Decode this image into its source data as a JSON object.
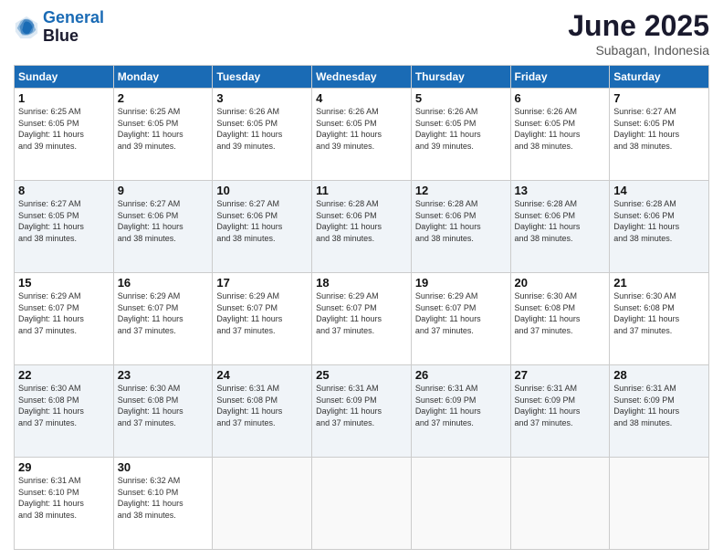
{
  "logo": {
    "line1": "General",
    "line2": "Blue"
  },
  "header": {
    "month": "June 2025",
    "location": "Subagan, Indonesia"
  },
  "weekdays": [
    "Sunday",
    "Monday",
    "Tuesday",
    "Wednesday",
    "Thursday",
    "Friday",
    "Saturday"
  ],
  "weeks": [
    [
      {
        "day": "1",
        "info": "Sunrise: 6:25 AM\nSunset: 6:05 PM\nDaylight: 11 hours\nand 39 minutes."
      },
      {
        "day": "2",
        "info": "Sunrise: 6:25 AM\nSunset: 6:05 PM\nDaylight: 11 hours\nand 39 minutes."
      },
      {
        "day": "3",
        "info": "Sunrise: 6:26 AM\nSunset: 6:05 PM\nDaylight: 11 hours\nand 39 minutes."
      },
      {
        "day": "4",
        "info": "Sunrise: 6:26 AM\nSunset: 6:05 PM\nDaylight: 11 hours\nand 39 minutes."
      },
      {
        "day": "5",
        "info": "Sunrise: 6:26 AM\nSunset: 6:05 PM\nDaylight: 11 hours\nand 39 minutes."
      },
      {
        "day": "6",
        "info": "Sunrise: 6:26 AM\nSunset: 6:05 PM\nDaylight: 11 hours\nand 38 minutes."
      },
      {
        "day": "7",
        "info": "Sunrise: 6:27 AM\nSunset: 6:05 PM\nDaylight: 11 hours\nand 38 minutes."
      }
    ],
    [
      {
        "day": "8",
        "info": "Sunrise: 6:27 AM\nSunset: 6:05 PM\nDaylight: 11 hours\nand 38 minutes."
      },
      {
        "day": "9",
        "info": "Sunrise: 6:27 AM\nSunset: 6:06 PM\nDaylight: 11 hours\nand 38 minutes."
      },
      {
        "day": "10",
        "info": "Sunrise: 6:27 AM\nSunset: 6:06 PM\nDaylight: 11 hours\nand 38 minutes."
      },
      {
        "day": "11",
        "info": "Sunrise: 6:28 AM\nSunset: 6:06 PM\nDaylight: 11 hours\nand 38 minutes."
      },
      {
        "day": "12",
        "info": "Sunrise: 6:28 AM\nSunset: 6:06 PM\nDaylight: 11 hours\nand 38 minutes."
      },
      {
        "day": "13",
        "info": "Sunrise: 6:28 AM\nSunset: 6:06 PM\nDaylight: 11 hours\nand 38 minutes."
      },
      {
        "day": "14",
        "info": "Sunrise: 6:28 AM\nSunset: 6:06 PM\nDaylight: 11 hours\nand 38 minutes."
      }
    ],
    [
      {
        "day": "15",
        "info": "Sunrise: 6:29 AM\nSunset: 6:07 PM\nDaylight: 11 hours\nand 37 minutes."
      },
      {
        "day": "16",
        "info": "Sunrise: 6:29 AM\nSunset: 6:07 PM\nDaylight: 11 hours\nand 37 minutes."
      },
      {
        "day": "17",
        "info": "Sunrise: 6:29 AM\nSunset: 6:07 PM\nDaylight: 11 hours\nand 37 minutes."
      },
      {
        "day": "18",
        "info": "Sunrise: 6:29 AM\nSunset: 6:07 PM\nDaylight: 11 hours\nand 37 minutes."
      },
      {
        "day": "19",
        "info": "Sunrise: 6:29 AM\nSunset: 6:07 PM\nDaylight: 11 hours\nand 37 minutes."
      },
      {
        "day": "20",
        "info": "Sunrise: 6:30 AM\nSunset: 6:08 PM\nDaylight: 11 hours\nand 37 minutes."
      },
      {
        "day": "21",
        "info": "Sunrise: 6:30 AM\nSunset: 6:08 PM\nDaylight: 11 hours\nand 37 minutes."
      }
    ],
    [
      {
        "day": "22",
        "info": "Sunrise: 6:30 AM\nSunset: 6:08 PM\nDaylight: 11 hours\nand 37 minutes."
      },
      {
        "day": "23",
        "info": "Sunrise: 6:30 AM\nSunset: 6:08 PM\nDaylight: 11 hours\nand 37 minutes."
      },
      {
        "day": "24",
        "info": "Sunrise: 6:31 AM\nSunset: 6:08 PM\nDaylight: 11 hours\nand 37 minutes."
      },
      {
        "day": "25",
        "info": "Sunrise: 6:31 AM\nSunset: 6:09 PM\nDaylight: 11 hours\nand 37 minutes."
      },
      {
        "day": "26",
        "info": "Sunrise: 6:31 AM\nSunset: 6:09 PM\nDaylight: 11 hours\nand 37 minutes."
      },
      {
        "day": "27",
        "info": "Sunrise: 6:31 AM\nSunset: 6:09 PM\nDaylight: 11 hours\nand 37 minutes."
      },
      {
        "day": "28",
        "info": "Sunrise: 6:31 AM\nSunset: 6:09 PM\nDaylight: 11 hours\nand 38 minutes."
      }
    ],
    [
      {
        "day": "29",
        "info": "Sunrise: 6:31 AM\nSunset: 6:10 PM\nDaylight: 11 hours\nand 38 minutes."
      },
      {
        "day": "30",
        "info": "Sunrise: 6:32 AM\nSunset: 6:10 PM\nDaylight: 11 hours\nand 38 minutes."
      },
      {
        "day": "",
        "info": ""
      },
      {
        "day": "",
        "info": ""
      },
      {
        "day": "",
        "info": ""
      },
      {
        "day": "",
        "info": ""
      },
      {
        "day": "",
        "info": ""
      }
    ]
  ]
}
